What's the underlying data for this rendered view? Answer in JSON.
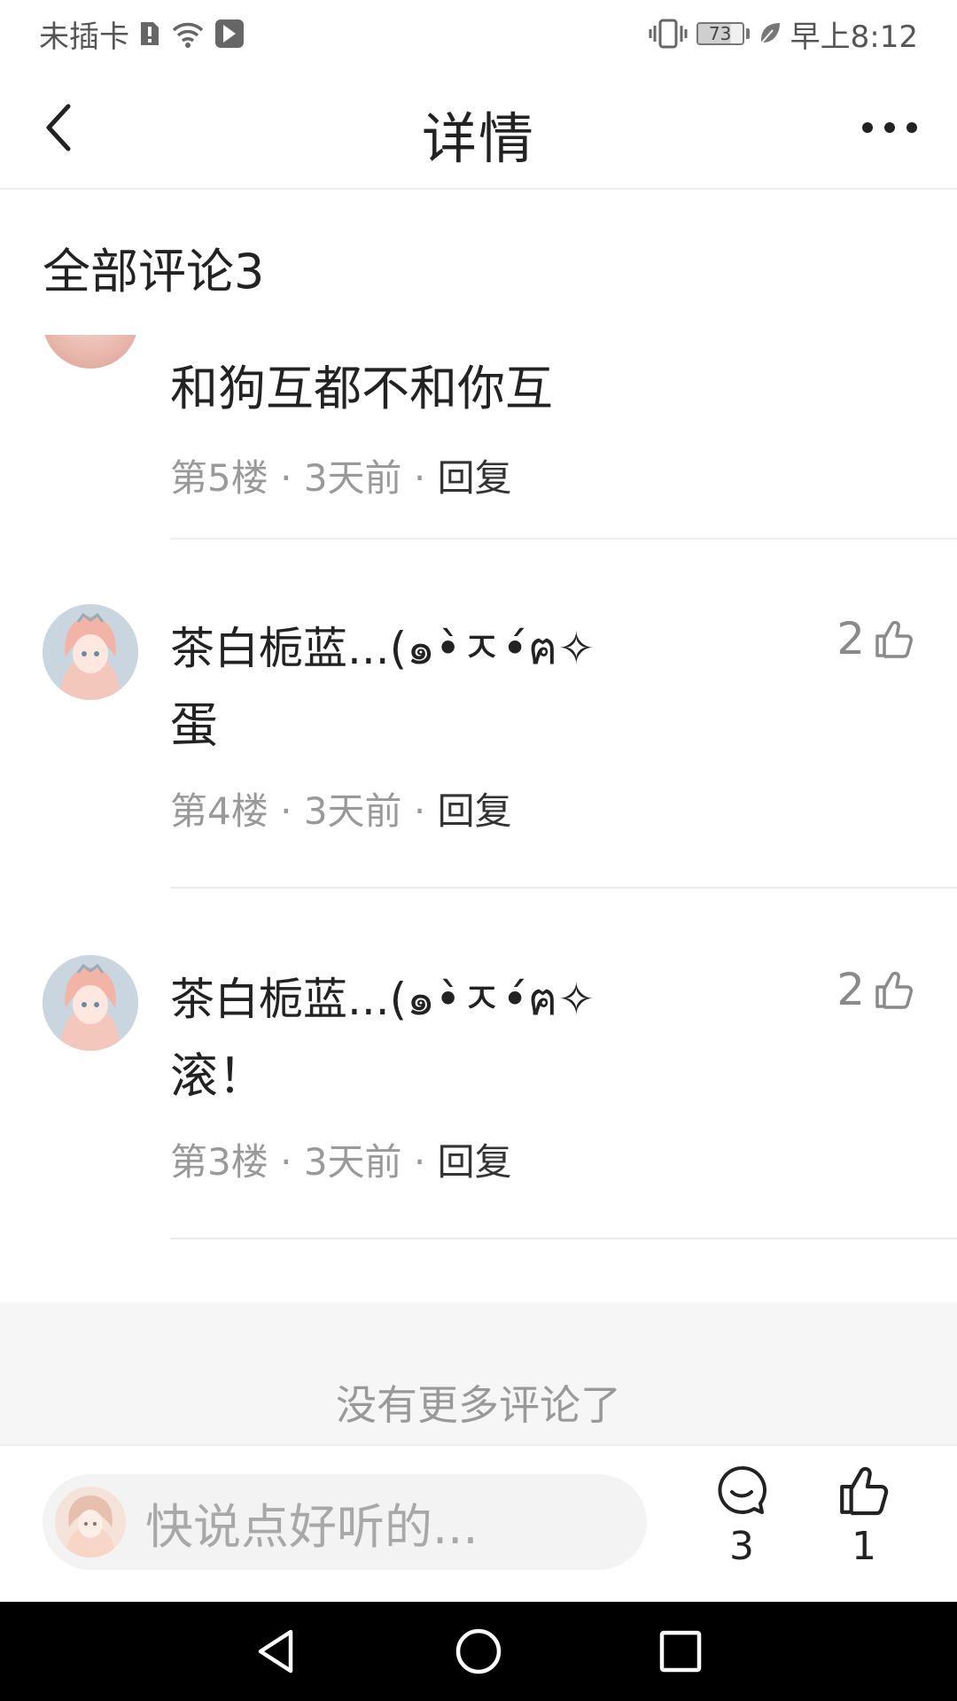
{
  "status_bar": {
    "carrier": "未插卡",
    "battery_level": "73",
    "time": "早上8:12"
  },
  "header": {
    "title": "详情"
  },
  "comments_section": {
    "title": "全部评论3",
    "partial_comment": {
      "text": "和狗互都不和你互",
      "floor": "第5楼",
      "time": "3天前",
      "reply_label": "回复"
    },
    "comments": [
      {
        "username": "茶白栀蓝...(๑•̀ㅈ•́ฅ✧",
        "likes": "2",
        "text": "蛋",
        "floor": "第4楼",
        "time": "3天前",
        "reply_label": "回复"
      },
      {
        "username": "茶白栀蓝...(๑•̀ㅈ•́ฅ✧",
        "likes": "2",
        "text": "滚！",
        "floor": "第3楼",
        "time": "3天前",
        "reply_label": "回复"
      }
    ],
    "separator": "·",
    "no_more_text": "没有更多评论了"
  },
  "bottom_bar": {
    "input_placeholder": "快说点好听的...",
    "comment_count": "3",
    "like_count": "1"
  },
  "icons": {
    "sim": "sim-alert-icon",
    "wifi": "wifi-icon",
    "notification": "app-notification-icon",
    "vibrate": "vibrate-icon",
    "leaf": "leaf-icon",
    "back": "back-arrow-icon",
    "more": "more-dots-icon",
    "like": "thumbs-up-icon",
    "comment": "comment-bubble-icon",
    "nav_back": "triangle-back-icon",
    "nav_home": "circle-home-icon",
    "nav_recent": "square-recent-icon"
  }
}
